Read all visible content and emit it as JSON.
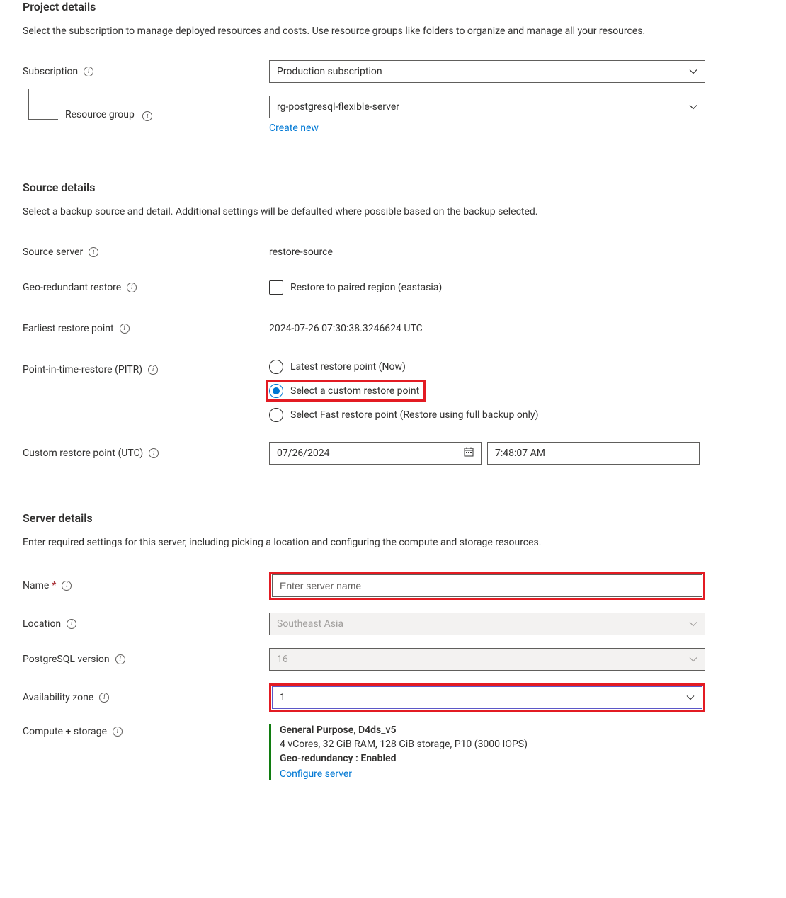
{
  "project": {
    "heading": "Project details",
    "description": "Select the subscription to manage deployed resources and costs. Use resource groups like folders to organize and manage all your resources.",
    "subscription_label": "Subscription",
    "subscription_value": "Production subscription",
    "resource_group_label": "Resource group",
    "resource_group_value": "rg-postgresql-flexible-server",
    "create_new_label": "Create new"
  },
  "source": {
    "heading": "Source details",
    "description": "Select a backup source and detail. Additional settings will be defaulted where possible based on the backup selected.",
    "source_server_label": "Source server",
    "source_server_value": "restore-source",
    "geo_restore_label": "Geo-redundant restore",
    "geo_restore_checkbox_label": "Restore to paired region (eastasia)",
    "earliest_label": "Earliest restore point",
    "earliest_value": "2024-07-26 07:30:38.3246624 UTC",
    "pitr_label": "Point-in-time-restore (PITR)",
    "pitr_options": {
      "latest": "Latest restore point (Now)",
      "custom": "Select a custom restore point",
      "fast": "Select Fast restore point (Restore using full backup only)"
    },
    "custom_point_label": "Custom restore point (UTC)",
    "custom_date": "07/26/2024",
    "custom_time": "7:48:07 AM"
  },
  "server": {
    "heading": "Server details",
    "description": "Enter required settings for this server, including picking a location and configuring the compute and storage resources.",
    "name_label": "Name",
    "name_placeholder": "Enter server name",
    "location_label": "Location",
    "location_value": "Southeast Asia",
    "pg_version_label": "PostgreSQL version",
    "pg_version_value": "16",
    "az_label": "Availability zone",
    "az_value": "1",
    "compute_label": "Compute + storage",
    "compute": {
      "sku": "General Purpose, D4ds_v5",
      "details": "4 vCores, 32 GiB RAM, 128 GiB storage, P10 (3000 IOPS)",
      "geo": "Geo-redundancy : Enabled",
      "configure_link": "Configure server"
    }
  },
  "icons": {
    "info": "i"
  }
}
